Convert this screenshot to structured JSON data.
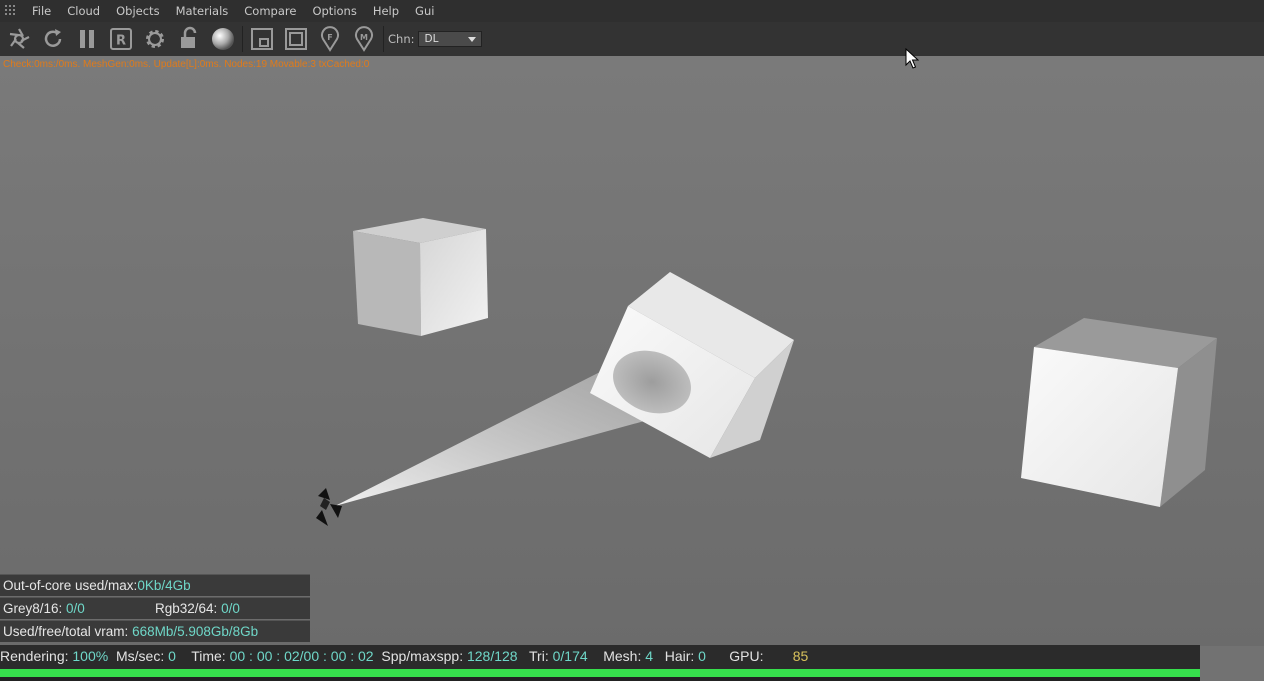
{
  "menu": {
    "items": [
      "File",
      "Cloud",
      "Objects",
      "Materials",
      "Compare",
      "Options",
      "Help",
      "Gui"
    ]
  },
  "toolbar": {
    "icons": [
      "camera-aperture-icon",
      "refresh-icon",
      "pause-icon",
      "r-render-icon",
      "gear-icon",
      "unlock-icon",
      "material-sphere-icon",
      "region-icon",
      "film-region-icon",
      "focus-pin-icon",
      "material-pin-icon"
    ],
    "chn_label": "Chn:",
    "chn_value": "DL"
  },
  "stats_line": "Check:0ms:/0ms. MeshGen:0ms. Update[L]:0ms. Nodes:19 Movable:3 txCached:0",
  "info": {
    "ooc_label": "Out-of-core used/max:",
    "ooc_value": "0Kb/4Gb",
    "grey_label": "Grey8/16:",
    "grey_value": "0/0",
    "rgb_label": "Rgb32/64:",
    "rgb_value": "0/0",
    "vram_label": "Used/free/total vram:",
    "vram_value": "668Mb/5.908Gb/8Gb"
  },
  "status": {
    "rendering_label": "Rendering:",
    "rendering_value": "100%",
    "ms_label": "Ms/sec:",
    "ms_value": "0",
    "time_label": "Time:",
    "time_value": "00 : 00 : 02/00 : 00 : 02",
    "spp_label": "Spp/maxspp:",
    "spp_value": "128/128",
    "tri_label": "Tri:",
    "tri_value": "0/174",
    "mesh_label": "Mesh:",
    "mesh_value": "4",
    "hair_label": "Hair:",
    "hair_value": "0",
    "gpu_label": "GPU:",
    "gpu_value": "85"
  },
  "progress": 1.0,
  "colors": {
    "accent_value": "#6fd7c8",
    "stats_orange": "#e07b1a",
    "progress_green": "#36e04c"
  }
}
